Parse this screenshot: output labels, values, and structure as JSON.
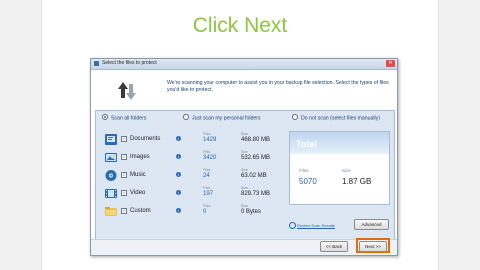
{
  "heading": "Click Next",
  "window": {
    "title": "Select the files to protect",
    "close_label": "✕",
    "intro": "We're scanning your computer to assist you in your backup file selection. Select the types of files you'd like to protect."
  },
  "scan_options": [
    {
      "label": "Scan all folders",
      "selected": true
    },
    {
      "label": "Just scan my personal folders",
      "selected": false
    },
    {
      "label": "Do not scan (select files manually)",
      "selected": false
    }
  ],
  "columns": {
    "files": "Files",
    "size": "Size"
  },
  "categories": [
    {
      "name": "Documents",
      "icon": "documents-icon",
      "checked": true,
      "files": "1429",
      "size": "468.80 MB"
    },
    {
      "name": "Images",
      "icon": "images-icon",
      "checked": true,
      "files": "3420",
      "size": "532.65 MB"
    },
    {
      "name": "Music",
      "icon": "music-icon",
      "checked": true,
      "files": "24",
      "size": "63.02 MB"
    },
    {
      "name": "Video",
      "icon": "video-icon",
      "checked": true,
      "files": "197",
      "size": "829.73 MB"
    },
    {
      "name": "Custom",
      "icon": "custom-folder-icon",
      "checked": true,
      "files": "0",
      "size": "0 Bytes"
    }
  ],
  "total": {
    "title": "Total",
    "files_label": "Files",
    "files": "5070",
    "size_label": "Size",
    "size": "1.87 GB"
  },
  "review_link": "Review Scan Results",
  "buttons": {
    "advanced": "Advanced",
    "back": "<< Back",
    "next": "Next >>"
  },
  "colors": {
    "heading": "#8cc63f",
    "highlight": "#e36c09",
    "accent": "#1f66b5"
  }
}
